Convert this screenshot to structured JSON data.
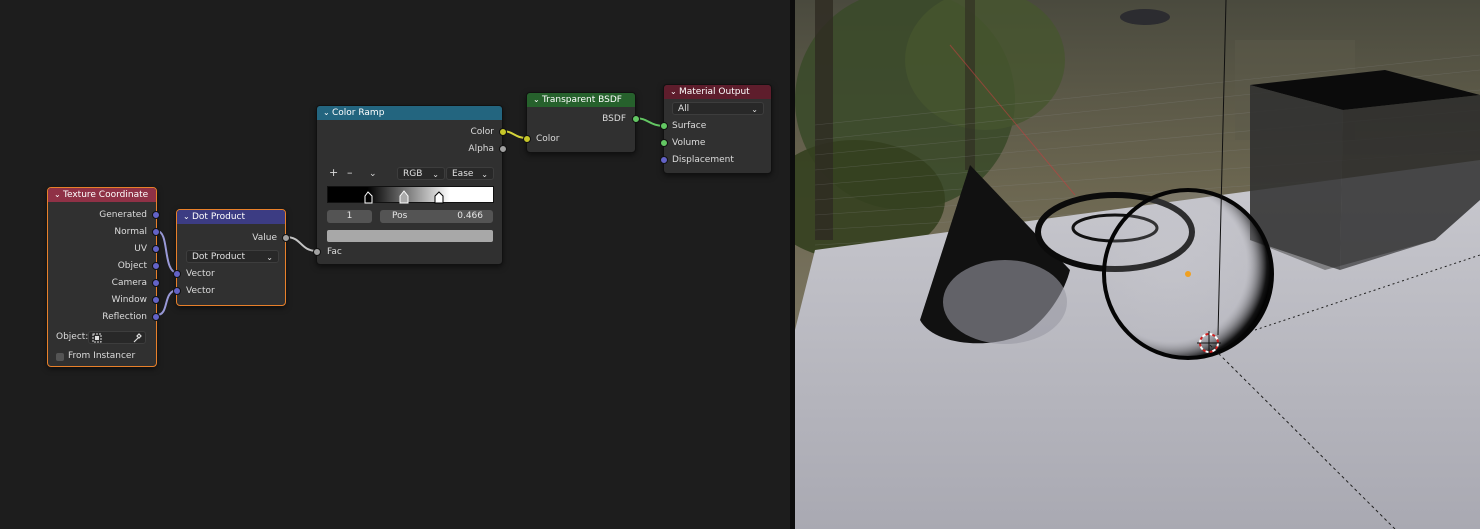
{
  "nodes": {
    "texcoord": {
      "title": "Texture Coordinate",
      "outputs": [
        "Generated",
        "Normal",
        "UV",
        "Object",
        "Camera",
        "Window",
        "Reflection"
      ],
      "object_label": "Object:",
      "from_instancer_label": "From Instancer",
      "header_color": "#8f3146"
    },
    "dot": {
      "title": "Dot Product",
      "output": "Value",
      "operation": "Dot Product",
      "inputs": [
        "Vector",
        "Vector"
      ],
      "header_color": "#3c3c83"
    },
    "ramp": {
      "title": "Color Ramp",
      "outputs": [
        "Color",
        "Alpha"
      ],
      "add_symbol": "+",
      "remove_symbol": "–",
      "color_mode": "RGB",
      "interpolation": "Ease",
      "stop_index": "1",
      "pos_label": "Pos",
      "pos_value": "0.466",
      "input": "Fac",
      "header_color": "#23657f"
    },
    "transparent": {
      "title": "Transparent BSDF",
      "output": "BSDF",
      "input": "Color",
      "header_color": "#26612c"
    },
    "output": {
      "title": "Material Output",
      "target": "All",
      "inputs": [
        "Surface",
        "Volume",
        "Displacement"
      ],
      "header_color": "#5e1d2c"
    }
  },
  "colors": {
    "socket_vector": "#6363c7",
    "socket_color": "#c7c729",
    "socket_float": "#a1a1a1",
    "socket_shader": "#63c763",
    "selection": "#e8802a"
  }
}
